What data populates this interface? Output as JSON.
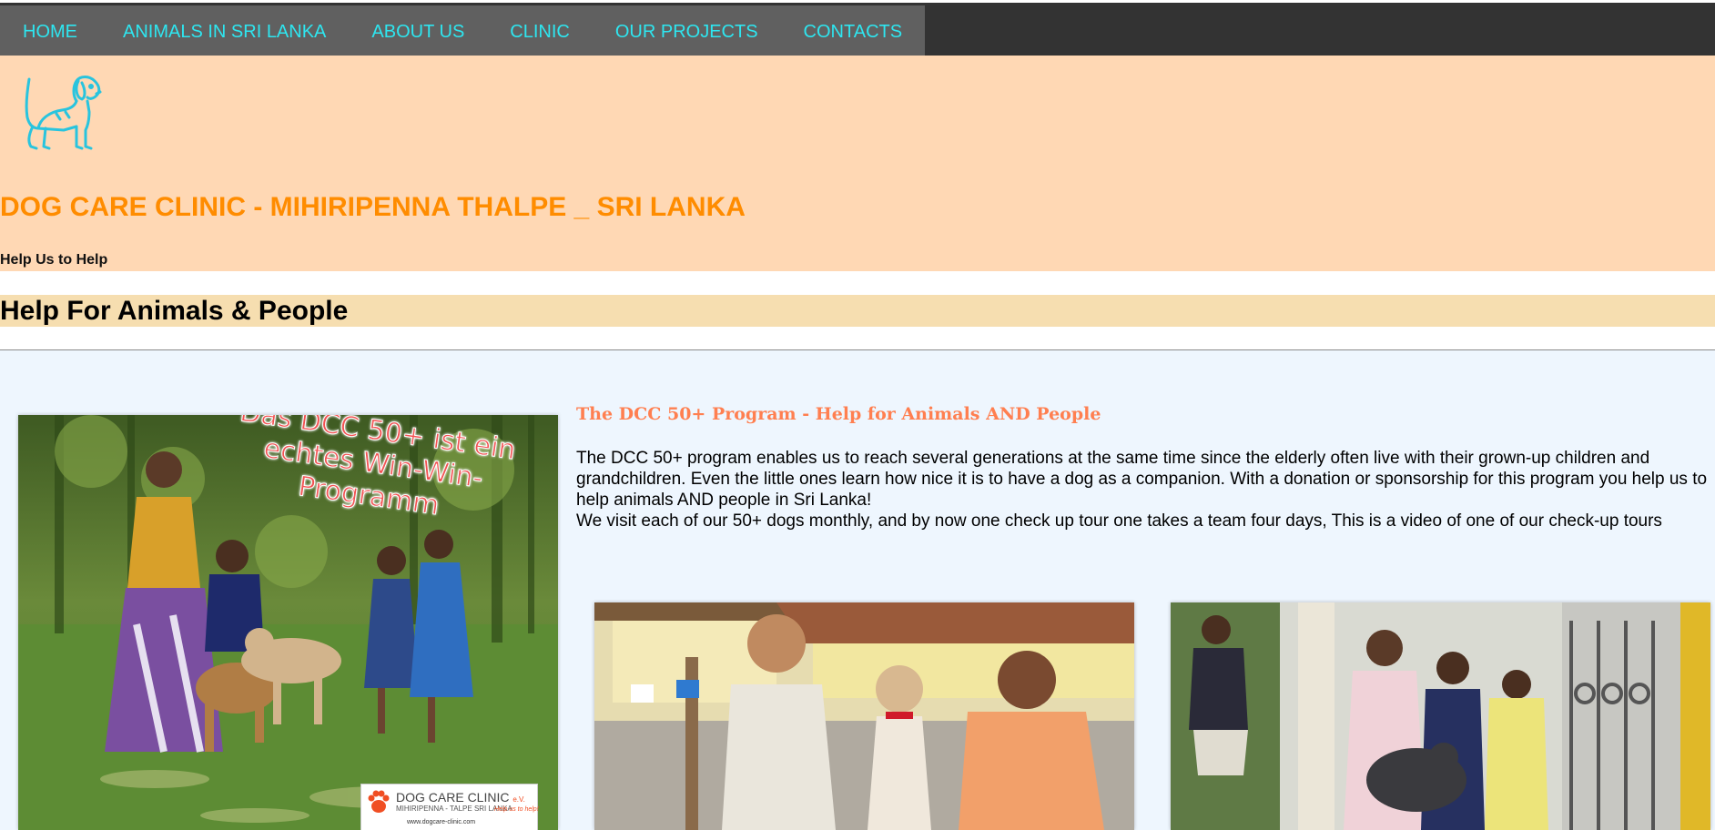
{
  "nav": {
    "items": [
      {
        "label": "HOME"
      },
      {
        "label": "ANIMALS IN SRI LANKA"
      },
      {
        "label": "ABOUT US"
      },
      {
        "label": "CLINIC"
      },
      {
        "label": "OUR PROJECTS"
      },
      {
        "label": "CONTACTS"
      }
    ]
  },
  "header": {
    "logo_icon": "dog-outline-icon",
    "title": "DOG CARE CLINIC - MIHIRIPENNA THALPE _ SRI LANKA",
    "tagline": "Help Us to Help"
  },
  "section": {
    "heading": "Help For Animals & People"
  },
  "article": {
    "title": "The DCC 50+ Program - Help for Animals AND People",
    "paragraph1": "The DCC 50+ program enables us to reach several generations at the same time since the elderly often live with their grown-up children and grandchildren. Even the little ones learn how nice it is to have a dog as a companion. With a donation or sponsorship for this program you help us to help animals AND people in Sri Lanka!",
    "paragraph2": "We visit each of our 50+ dogs monthly, and by now one check up tour one takes a team four days, This is a video of one of our check-up tours"
  },
  "photo_main": {
    "overlay_text": "Das DCC 50+ ist ein echtes Win-Win-Programm",
    "logo_name": "DOG CARE CLINIC",
    "logo_suffix": "e.V.",
    "logo_sub": "MIHIRIPENNA - TALPE SRI LANKA",
    "logo_slogan": "Help us to help!",
    "logo_url": "www.dogcare-clinic.com"
  },
  "colors": {
    "nav_text": "#2ee6f0",
    "title": "#ff8c00",
    "header_bg": "#ffd8b4",
    "section_bg": "#f6deb0",
    "article_title": "#ff7f50",
    "content_bg": "#eef6fe"
  }
}
